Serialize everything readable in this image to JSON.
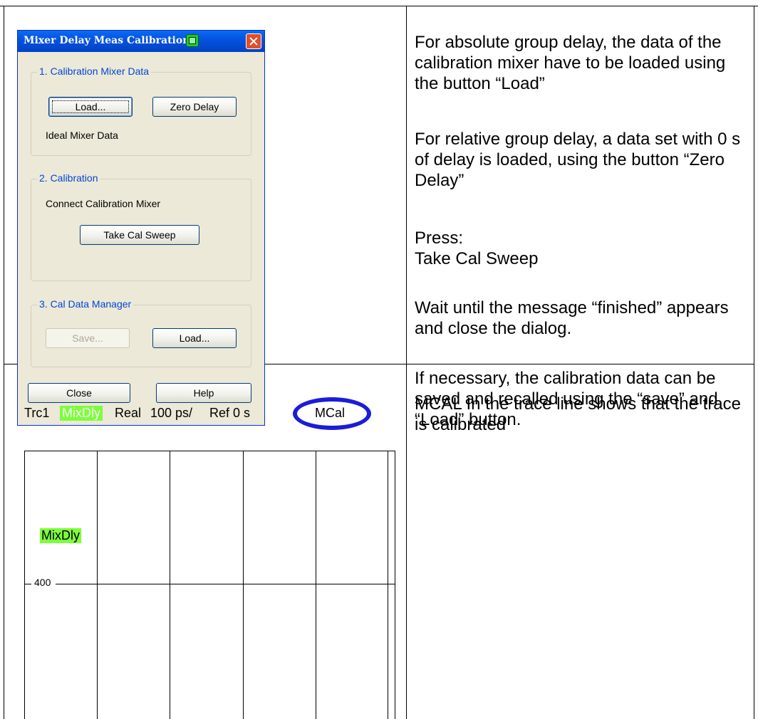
{
  "dialog": {
    "title": "Mixer Delay Meas Calibration",
    "group1": {
      "legend": "1. Calibration Mixer Data",
      "load_label": "Load...",
      "zero_delay_label": "Zero Delay",
      "status": "Ideal Mixer Data"
    },
    "group2": {
      "legend": "2. Calibration",
      "instruction": "Connect Calibration Mixer",
      "take_cal_sweep_label": "Take Cal Sweep"
    },
    "group3": {
      "legend": "3. Cal Data Manager",
      "save_label": "Save...",
      "load_label": "Load..."
    },
    "close_label": "Close",
    "help_label": "Help"
  },
  "explanation": {
    "para1": "For absolute group delay, the data of the calibration mixer have to be loaded using the button “Load”",
    "para2": "For relative group delay, a data set with 0 s of delay is loaded, using the button “Zero Delay”",
    "para3_line1": "Press:",
    "para3_line2": "Take Cal Sweep",
    "para4": "Wait until the message “finished” appears and close the dialog.",
    "para5": "If necessary, the calibration data can be saved and recalled using the “save” and “Load” button.",
    "mcal_note": "MCAL In the trace line shows that the trace is calibrated"
  },
  "trace": {
    "trace_name": "Trc1",
    "measurement": "MixDly",
    "format": "Real",
    "scale": "100 ps/",
    "ref": "Ref 0 s",
    "mcal": "MCal",
    "diagram_label": "MixDly",
    "y_tick": "400"
  },
  "colors": {
    "highlight": "#7cff3a",
    "ring": "#1c1cd8",
    "dialog_bg": "#ece9d8",
    "title_bar": "#0553e0",
    "legend_text": "#0046d5"
  }
}
